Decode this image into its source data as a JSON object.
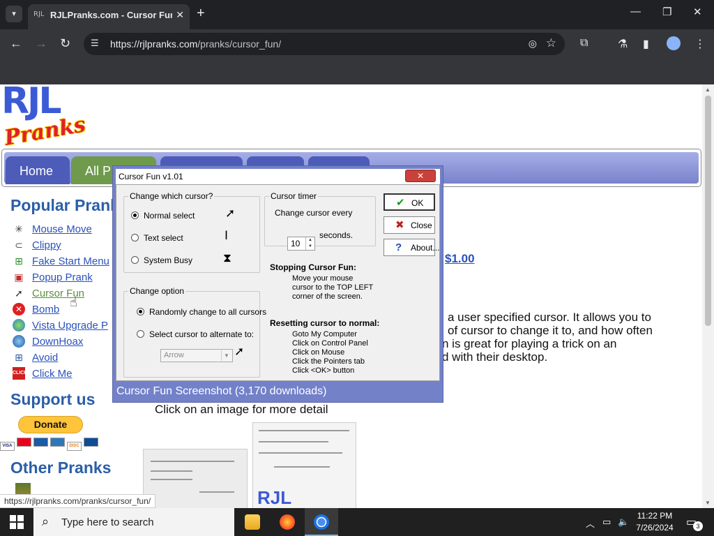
{
  "browser": {
    "tab_title": "RJLPranks.com - Cursor Fun",
    "tab_favicon_text": "RJL",
    "url_host": "https://rjlpranks.com",
    "url_path": "/pranks/cursor_fun/",
    "status_url": "https://rjlpranks.com/pranks/cursor_fun/"
  },
  "site": {
    "logo_top": "RJL",
    "logo_bottom": "Pranks",
    "nav_tabs": [
      {
        "label": "Home",
        "color": "#4d5cb8"
      },
      {
        "label": "All P",
        "color": "#6f9a4c"
      },
      {
        "label": "",
        "color": "#4d5cb8"
      },
      {
        "label": "",
        "color": "#4d5cb8"
      },
      {
        "label": "",
        "color": "#4d5cb8"
      }
    ],
    "sidebar": {
      "popular_heading": "Popular Pranl",
      "items": [
        {
          "label": "Mouse Move",
          "icon": "mouse-move-icon"
        },
        {
          "label": "Clippy",
          "icon": "paperclip-icon"
        },
        {
          "label": "Fake Start Menu",
          "icon": "windows-flag-icon"
        },
        {
          "label": "Popup Prank",
          "icon": "popup-icon"
        },
        {
          "label": "Cursor Fun",
          "icon": "cursor-icon"
        },
        {
          "label": "Bomb",
          "icon": "bomb-icon"
        },
        {
          "label": "Vista Upgrade P",
          "icon": "vista-globe-icon"
        },
        {
          "label": "DownHoax",
          "icon": "globe-icon"
        },
        {
          "label": "Avoid",
          "icon": "avoid-icon"
        },
        {
          "label": "Click Me",
          "icon": "click-me-icon"
        }
      ],
      "support_heading": "Support us",
      "donate_label": "Donate",
      "other_heading": "Other Pranks"
    },
    "content": {
      "price": "$1.00",
      "desc_lines": [
        "a user specified cursor. It allows you to",
        "of cursor to change it to, and how often",
        "n is great for playing a trick on an",
        "d with their desktop."
      ],
      "click_detail": "Click on an image for more detail"
    }
  },
  "dialog": {
    "title": "Cursor Fun v1.01",
    "close_label": "✕",
    "change_cursor_legend": "Change which cursor?",
    "cursor_options": [
      {
        "label": "Normal select",
        "selected": true
      },
      {
        "label": "Text select",
        "selected": false
      },
      {
        "label": "System Busy",
        "selected": false
      }
    ],
    "change_option_legend": "Change option",
    "change_options": [
      {
        "label": "Randomly change to all cursors",
        "selected": true
      },
      {
        "label": "Select cursor to alternate to:",
        "selected": false
      }
    ],
    "alternate_combo_value": "Arrow",
    "timer_legend": "Cursor timer",
    "timer_label": "Change cursor every",
    "timer_value": "10",
    "timer_unit": "seconds.",
    "buttons": {
      "ok": "OK",
      "close": "Close",
      "about": "About..."
    },
    "stopping_heading": "Stopping Cursor Fun:",
    "stopping_lines": [
      "Move your mouse",
      "cursor to the TOP LEFT",
      "corner of the screen."
    ],
    "resetting_heading": "Resetting cursor to normal:",
    "resetting_lines": [
      "Goto My Computer",
      "Click on Control Panel",
      "Click on Mouse",
      "Click the Pointers tab",
      "Click <OK> button"
    ],
    "caption": "Cursor Fun Screenshot (3,170 downloads)"
  },
  "taskbar": {
    "search_placeholder": "Type here to search",
    "time": "11:22 PM",
    "date": "7/26/2024",
    "notification_count": "3"
  }
}
